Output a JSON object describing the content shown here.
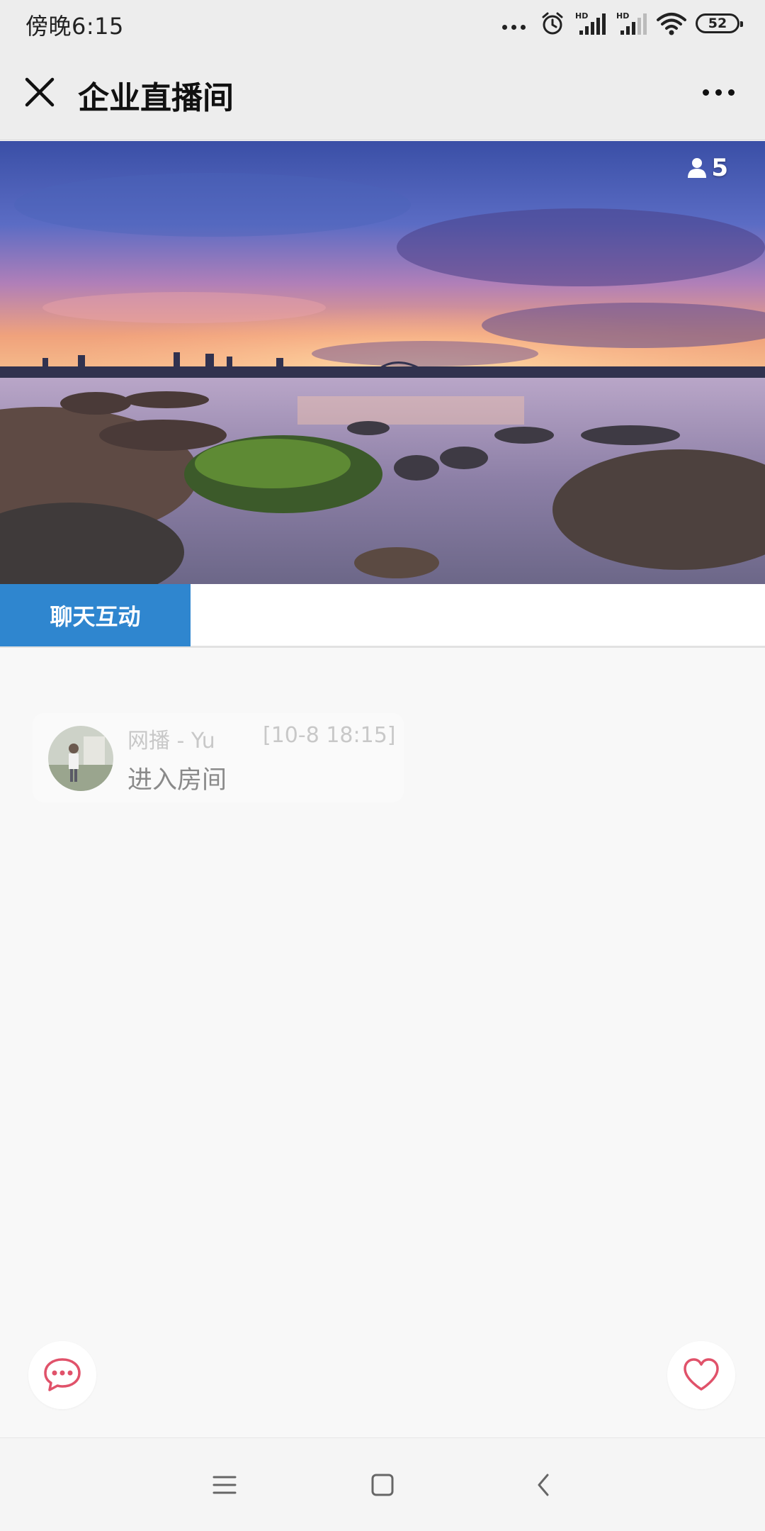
{
  "status_bar": {
    "time": "傍晚6:15",
    "network_1": "HD",
    "network_2": "HD",
    "battery": "52",
    "icons": [
      "more-dots-icon",
      "alarm-icon",
      "signal-icon",
      "signal-icon",
      "wifi-icon",
      "battery-icon"
    ]
  },
  "header": {
    "title": "企业直播间",
    "close_icon": "close-icon",
    "more_icon": "more-icon"
  },
  "banner": {
    "viewer_count": "5",
    "viewer_icon": "user-icon",
    "image": "sunset-harbor-photo"
  },
  "tabs": [
    {
      "label": "聊天互动",
      "active": true
    }
  ],
  "chat": {
    "messages": [
      {
        "user": "网播 - Yu",
        "time": "[10-8 18:15]",
        "text": "进入房间"
      }
    ]
  },
  "actions": {
    "chat_icon": "chat-bubble-icon",
    "like_icon": "heart-icon"
  },
  "colors": {
    "accent": "#2f86cf",
    "action_icon": "#e0526a",
    "header_bg": "#ededed",
    "content_bg": "#f8f8f8"
  },
  "nav": {
    "icons": [
      "menu-icon",
      "home-icon",
      "back-icon"
    ]
  }
}
